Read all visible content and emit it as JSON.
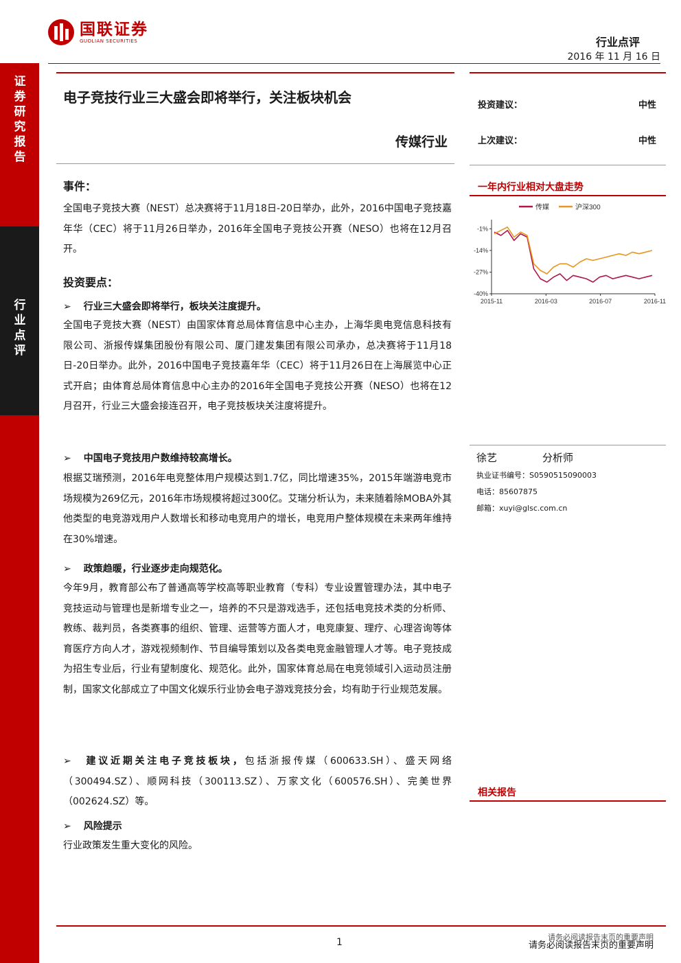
{
  "header": {
    "logo_cn": "国联证券",
    "logo_en": "GUOLIAN SECURITIES",
    "doc_type": "行业点评",
    "date": "2016 年 11 月 16 日"
  },
  "sidebar": {
    "top_label": "证券研究报告",
    "dark_label": "行业点评"
  },
  "title": "电子竞技行业三大盛会即将举行，关注板块机会",
  "industry": "传媒行业",
  "rating": {
    "invest_label": "投资建议：",
    "invest_value": "中性",
    "prev_label": "上次建议：",
    "prev_value": "中性"
  },
  "chart_panel_title": "一年内行业相对大盘走势",
  "chart_data": {
    "type": "line",
    "series": [
      {
        "name": "传媒",
        "color": "#b0164b",
        "values": [
          -3,
          -5,
          -2,
          -8,
          -4,
          -6,
          -25,
          -31,
          -33,
          -30,
          -28,
          -32,
          -29,
          -30,
          -31,
          -33,
          -30,
          -29,
          -31,
          -30,
          -29,
          -30,
          -31,
          -30,
          -29
        ]
      },
      {
        "name": "沪深300",
        "color": "#e8961e",
        "values": [
          -4,
          -2,
          0,
          -6,
          -3,
          -5,
          -22,
          -26,
          -28,
          -24,
          -22,
          -22,
          -24,
          -21,
          -19,
          -20,
          -19,
          -18,
          -17,
          -16,
          -17,
          -15,
          -16,
          -15,
          -14
        ]
      }
    ],
    "x_ticks": [
      "2015-11",
      "2016-03",
      "2016-07",
      "2016-11"
    ],
    "y_ticks": [
      "-1%",
      "-14%",
      "-27%",
      "-40%"
    ],
    "ylim": [
      -40,
      2
    ],
    "grid": false,
    "legend": "top"
  },
  "analyst": {
    "name": "徐艺",
    "role": "分析师",
    "cert_label": "执业证书编号：",
    "cert": "S0590515090003",
    "phone_label": "电话：",
    "phone": "85607875",
    "email_label": "邮箱：",
    "email": "xuyi@glsc.com.cn"
  },
  "related_title": "相关报告",
  "event_head": "事件：",
  "event_text": "全国电子竞技大赛（NEST）总决赛将于11月18日-20日举办，此外，2016中国电子竞技嘉年华（CEC）将于11月26日举办，2016年全国电子竞技公开赛（NESO）也将在12月召开。",
  "points_head": "投资要点：",
  "points": [
    {
      "title": "行业三大盛会即将举行，板块关注度提升。",
      "text": "全国电子竞技大赛（NEST）由国家体育总局体育信息中心主办，上海华奥电竞信息科技有限公司、浙报传媒集团股份有限公司、厦门建发集团有限公司承办，总决赛将于11月18日-20日举办。此外，2016中国电子竞技嘉年华（CEC）将于11月26日在上海展览中心正式开启；由体育总局体育信息中心主办的2016年全国电子竞技公开赛（NESO）也将在12月召开，行业三大盛会接连召开，电子竞技板块关注度将提升。"
    },
    {
      "title": "中国电子竞技用户数维持较高增长。",
      "text": "根据艾瑞预测，2016年电竞整体用户规模达到1.7亿，同比增速35%，2015年端游电竞市场规模为269亿元，2016年市场规模将超过300亿。艾瑞分析认为，未来随着除MOBA外其他类型的电竞游戏用户人数增长和移动电竞用户的增长，电竞用户整体规模在未来两年维持在30%增速。"
    },
    {
      "title": "政策趋暖，行业逐步走向规范化。",
      "text": "今年9月，教育部公布了普通高等学校高等职业教育（专科）专业设置管理办法，其中电子竞技运动与管理也是新增专业之一，培养的不只是游戏选手，还包括电竞技术类的分析师、教练、裁判员，各类赛事的组织、管理、运营等方面人才，电竞康复、理疗、心理咨询等体育医疗方向人才，游戏视频制作、节目编导策划以及各类电竞金融管理人才等。电子竞技成为招生专业后，行业有望制度化、规范化。此外，国家体育总局在电竞领域引入运动员注册制，国家文化部成立了中国文化娱乐行业协会电子游戏竞技分会，均有助于行业规范发展。"
    }
  ],
  "recommend": {
    "bold": "建议近期关注电子竞技板块，",
    "text": "包括浙报传媒（600633.SH）、盛天网络（300494.SZ）、顺网科技（300113.SZ）、万家文化（600576.SH）、完美世界（002624.SZ）等。"
  },
  "risk": {
    "title": "风险提示",
    "text": "行业政策发生重大变化的风险。"
  },
  "footer": {
    "page": "1",
    "note_small": "请务必阅读报告末页的重要声明",
    "note": "请务必阅读报告末页的重要声明"
  }
}
